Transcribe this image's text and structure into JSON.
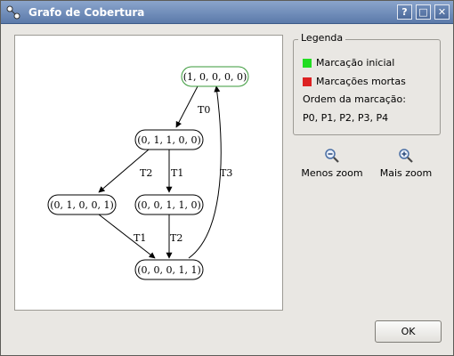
{
  "window": {
    "title": "Grafo de Cobertura",
    "buttons": {
      "help": "?",
      "maximize": "□",
      "close": "✕"
    }
  },
  "graph": {
    "nodes": {
      "n1": "(1, 0, 0, 0, 0)",
      "n2": "(0, 1, 1, 0, 0)",
      "n3": "(0, 1, 0, 0, 1)",
      "n4": "(0, 0, 1, 1, 0)",
      "n5": "(0, 0, 0, 1, 1)"
    },
    "edges": {
      "e1": "T0",
      "e2": "T2",
      "e3": "T1",
      "e4": "T1",
      "e5": "T2",
      "e6": "T3"
    },
    "initial_color": "#3a9a3a"
  },
  "legend": {
    "title": "Legenda",
    "initial": {
      "label": "Marcação inicial",
      "color": "#22dd22"
    },
    "dead": {
      "label": "Marcações mortas",
      "color": "#dd2222"
    },
    "order_title": "Ordem da marcação:",
    "order_value": "P0, P1, P2, P3, P4"
  },
  "zoom": {
    "out_label": "Menos zoom",
    "in_label": "Mais zoom",
    "out_icon": "zoom-out-icon",
    "in_icon": "zoom-in-icon"
  },
  "ok_label": "OK"
}
